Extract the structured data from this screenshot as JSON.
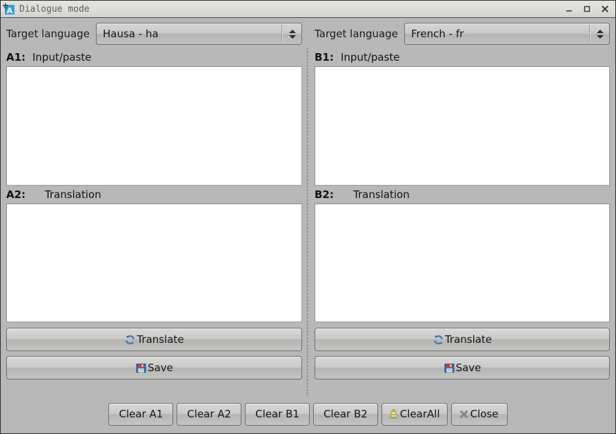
{
  "window": {
    "title": "Dialogue mode",
    "icon": "translate-app-icon",
    "controls": {
      "minimize": "minimize-icon",
      "maximize": "maximize-icon",
      "close": "close-icon"
    }
  },
  "panes": {
    "a": {
      "language": {
        "label": "Target language",
        "value": "Hausa - ha"
      },
      "input": {
        "tag": "A1:",
        "desc": "Input/paste",
        "value": ""
      },
      "translation": {
        "tag": "A2:",
        "desc": "Translation",
        "value": ""
      },
      "translate_button": "Translate",
      "save_button": "Save"
    },
    "b": {
      "language": {
        "label": "Target language",
        "value": "French - fr"
      },
      "input": {
        "tag": "B1:",
        "desc": "Input/paste",
        "value": ""
      },
      "translation": {
        "tag": "B2:",
        "desc": "Translation",
        "value": ""
      },
      "translate_button": "Translate",
      "save_button": "Save"
    }
  },
  "bottom_buttons": [
    {
      "label": "Clear A1",
      "icon": null
    },
    {
      "label": "Clear A2",
      "icon": null
    },
    {
      "label": "Clear B1",
      "icon": null
    },
    {
      "label": "Clear B2",
      "icon": null
    },
    {
      "label": "ClearAll",
      "icon": "broom-icon"
    },
    {
      "label": "Close",
      "icon": "cancel-x-icon"
    }
  ],
  "icons": {
    "translate": "refresh-cycle-icon",
    "save": "floppy-disk-icon"
  },
  "colors": {
    "window_background": "#b8b8b8",
    "titlebar": "#dedeDA",
    "title_text": "#5c5c5c",
    "text_area": "#ffffff",
    "button_face": "#c8c8c6",
    "accent_icon_blue": "#3a6ea5",
    "save_icon_red": "#c0392b",
    "broom_yellow": "#d9d06a"
  }
}
